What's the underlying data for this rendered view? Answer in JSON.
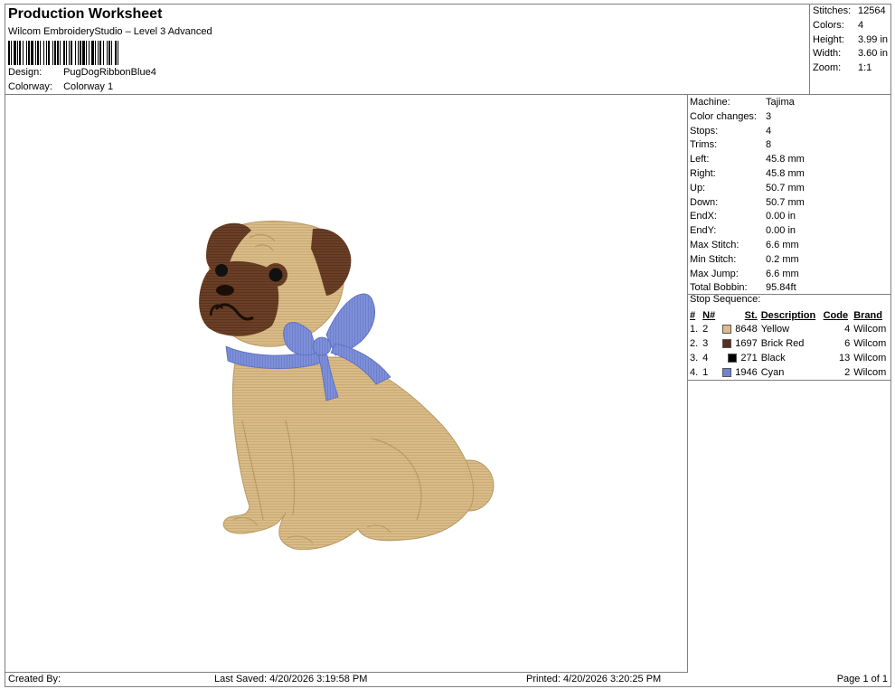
{
  "header": {
    "title": "Production Worksheet",
    "subtitle": "Wilcom EmbroideryStudio – Level 3 Advanced",
    "design_label": "Design:",
    "design_value": "PugDogRibbonBlue4",
    "colorway_label": "Colorway:",
    "colorway_value": "Colorway 1"
  },
  "stats": [
    {
      "label": "Stitches:",
      "value": "12564"
    },
    {
      "label": "Colors:",
      "value": "4"
    },
    {
      "label": "Height:",
      "value": "3.99 in"
    },
    {
      "label": "Width:",
      "value": "3.60 in"
    },
    {
      "label": "Zoom:",
      "value": "1:1"
    }
  ],
  "machine_info": [
    {
      "label": "Machine:",
      "value": "Tajima"
    },
    {
      "label": "Color changes:",
      "value": "3"
    },
    {
      "label": "Stops:",
      "value": "4"
    },
    {
      "label": "Trims:",
      "value": "8"
    },
    {
      "label": "Left:",
      "value": "45.8 mm"
    },
    {
      "label": "Right:",
      "value": "45.8 mm"
    },
    {
      "label": "Up:",
      "value": "50.7 mm"
    },
    {
      "label": "Down:",
      "value": "50.7 mm"
    },
    {
      "label": "EndX:",
      "value": "0.00 in"
    },
    {
      "label": "EndY:",
      "value": "0.00 in"
    },
    {
      "label": "Max Stitch:",
      "value": "6.6 mm"
    },
    {
      "label": "Min Stitch:",
      "value": "0.2 mm"
    },
    {
      "label": "Max Jump:",
      "value": "6.6 mm"
    },
    {
      "label": "Total Bobbin:",
      "value": "95.84ft"
    }
  ],
  "stop_sequence": {
    "title": "Stop Sequence:",
    "columns": [
      "#",
      "N#",
      "St.",
      "Description",
      "Code",
      "Brand"
    ],
    "rows": [
      {
        "idx": "1.",
        "n": "2",
        "color": "#e2b98a",
        "st": "8648",
        "desc": "Yellow",
        "code": "4",
        "brand": "Wilcom"
      },
      {
        "idx": "2.",
        "n": "3",
        "color": "#5a2e1a",
        "st": "1697",
        "desc": "Brick Red",
        "code": "6",
        "brand": "Wilcom"
      },
      {
        "idx": "3.",
        "n": "4",
        "color": "#000000",
        "st": "271",
        "desc": "Black",
        "code": "13",
        "brand": "Wilcom"
      },
      {
        "idx": "4.",
        "n": "1",
        "color": "#6f83d6",
        "st": "1946",
        "desc": "Cyan",
        "code": "2",
        "brand": "Wilcom"
      }
    ]
  },
  "footer": {
    "created_by": "Created By:",
    "last_saved": "Last Saved: 4/20/2026 3:19:58 PM",
    "printed": "Printed: 4/20/2026 3:20:25 PM",
    "page": "Page 1 of 1"
  },
  "colors": {
    "fawn": "#d9bb87",
    "fawn_dark": "#b89a66",
    "mask": "#6b3f26",
    "ribbon": "#7d8fd9",
    "ribbon_dark": "#5a6cc0"
  }
}
